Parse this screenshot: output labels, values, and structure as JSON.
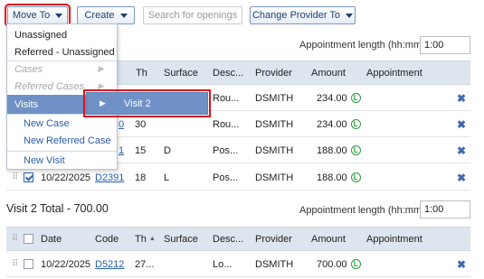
{
  "toolbar": {
    "move_to": "Move To",
    "create": "Create",
    "search_placeholder": "Search for openings",
    "change_provider": "Change Provider To"
  },
  "menu": {
    "unassigned": "Unassigned",
    "referred_unassigned": "Referred - Unassigned",
    "cases": "Cases",
    "referred_cases": "Referred Cases",
    "visits": "Visits",
    "new_case": "New Case",
    "new_referred_case": "New Referred Case",
    "new_visit": "New Visit"
  },
  "submenu": {
    "visit2": "Visit 2"
  },
  "appointment_length_label": "Appointment length (hh:mm)",
  "appointment_length_value_1": "1:00",
  "appointment_length_value_2": "1:00",
  "columns": {
    "date": "Date",
    "code": "Code",
    "th": "Th",
    "surface": "Surface",
    "desc": "Desc...",
    "provider": "Provider",
    "amount": "Amount",
    "appointment": "Appointment"
  },
  "grid1": {
    "rows": [
      {
        "date": "",
        "code": "",
        "th": "",
        "surface": "",
        "desc": "Rou...",
        "provider": "DSMITH",
        "amount": "234.00"
      },
      {
        "date": "",
        "code": "0",
        "th": "30",
        "surface": "",
        "desc": "Rou...",
        "provider": "DSMITH",
        "amount": "234.00"
      },
      {
        "date": "",
        "code": "1",
        "th": "15",
        "surface": "D",
        "desc": "Pos...",
        "provider": "DSMITH",
        "amount": "188.00"
      },
      {
        "date": "10/22/2025",
        "code": "D2391",
        "th": "18",
        "surface": "L",
        "desc": "Pos...",
        "provider": "DSMITH",
        "amount": "188.00"
      }
    ]
  },
  "visit2_title": "Visit 2 Total - 700.00",
  "grid2": {
    "rows": [
      {
        "date": "10/22/2025",
        "code": "D5212",
        "th": "27...",
        "surface": "",
        "desc": "Lo...",
        "provider": "DSMITH",
        "amount": "700.00"
      }
    ]
  },
  "status_letter": "L",
  "colors": {
    "accent": "#6f91c6",
    "highlight_border": "#e01010",
    "link": "#2860a8",
    "status_green": "#2f9a3a"
  }
}
